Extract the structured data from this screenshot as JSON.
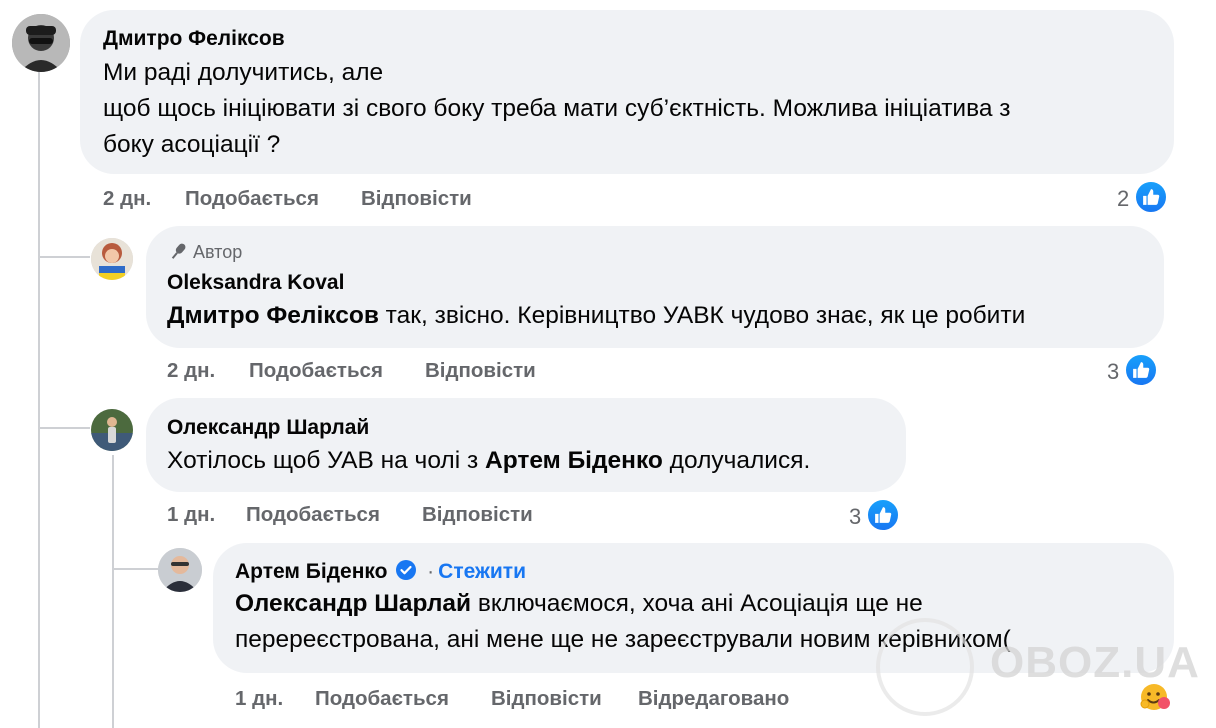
{
  "comments": [
    {
      "author": "Дмитро Феліксов",
      "lines": [
        "Ми раді долучитись, але",
        "щоб щось ініціювати зі свого боку треба мати суб’єктність. Можлива ініціатива з",
        "боку асоціації ?"
      ],
      "time": "2 дн.",
      "like_label": "Подобається",
      "reply_label": "Відповісти",
      "reactions": "2"
    },
    {
      "badge": "Автор",
      "author": "Oleksandra Koval",
      "mention": "Дмитро Феліксов",
      "text": " так, звісно. Керівництво УАВК чудово знає, як це робити",
      "time": "2 дн.",
      "like_label": "Подобається",
      "reply_label": "Відповісти",
      "reactions": "3"
    },
    {
      "author": "Олександр Шарлай",
      "text_before": "Хотілось щоб УАВ на чолі з ",
      "mention": "Артем Біденко",
      "text_after": " долучалися.",
      "time": "1 дн.",
      "like_label": "Подобається",
      "reply_label": "Відповісти",
      "reactions": "3"
    },
    {
      "author": "Артем Біденко",
      "follow_label": "Стежити",
      "separator": "·",
      "mention": "Олександр Шарлай",
      "text_line1": " включаємося, хоча ані Асоціація ще не",
      "text_line2": "перереєстрована, ані мене ще не зареєстрували новим керівником(",
      "time": "1 дн.",
      "like_label": "Подобається",
      "reply_label": "Відповісти",
      "edited_label": "Відредаговано"
    }
  ],
  "watermark": "OBOZ.UA",
  "colors": {
    "bubble": "#f0f2f5",
    "meta": "#65676b",
    "accent": "#1877f2"
  }
}
